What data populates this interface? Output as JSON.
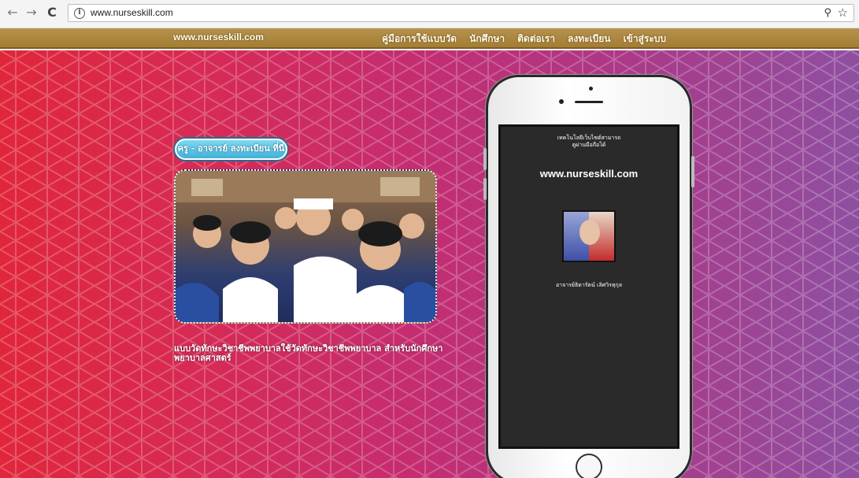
{
  "browser": {
    "url": "www.nurseskill.com",
    "back_glyph": "←",
    "forward_glyph": "→",
    "reload_glyph": "C",
    "info_glyph": "i",
    "zoom_glyph": "⚲",
    "star_glyph": "☆"
  },
  "site": {
    "brand": "www.nurseskill.com",
    "nav": [
      "คู่มือการใช้แบบวัด",
      "นักศึกษา",
      "ติดต่อเรา",
      "ลงทะเบียน",
      "เข้าสู่ระบบ"
    ]
  },
  "hero": {
    "register_button": "ครู - อาจารย์ ลงทะเบียน ที่นี่",
    "caption": "แบบวัดทักษะวิชาชีพพยาบาลใช้วัดทักษะวิชาชีพพยาบาล สำหรับนักศึกษาพยาบาลศาสตร์"
  },
  "phone_screen": {
    "tagline_line1": "เทคโนโลยีเว็บไซต์สามารถ",
    "tagline_line2": "ดูผ่านมือถือได้",
    "url": "www.nurseskill.com",
    "name": "อาจารย์ธิดารัตน์ เลิศวิรทุกุล"
  },
  "colors": {
    "navbar": "#a57d33",
    "hero_left": "#e0263a",
    "hero_right": "#8f4fa0",
    "register_button": "#3fb2d9",
    "phone_screen": "#2a2a2a"
  }
}
